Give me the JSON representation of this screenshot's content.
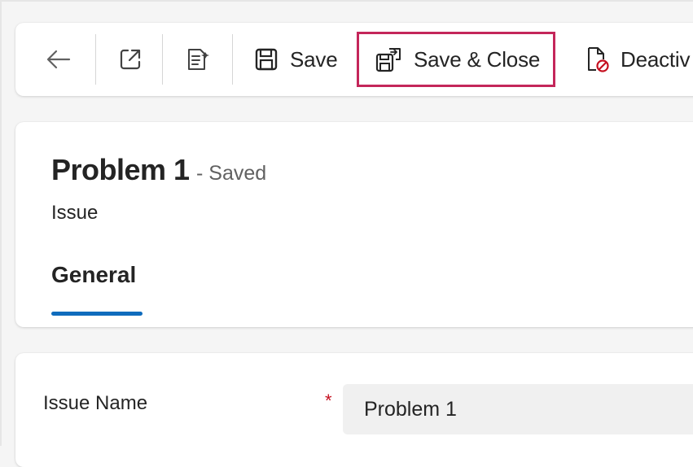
{
  "toolbar": {
    "back_icon": "back-arrow-icon",
    "popout_icon": "open-in-new-window-icon",
    "flow_icon": "flow-document-icon",
    "save_label": "Save",
    "save_close_label": "Save & Close",
    "deactivate_label": "Deactiv",
    "highlight_color": "#c4265a"
  },
  "header": {
    "title": "Problem 1",
    "status": "- Saved",
    "entity": "Issue",
    "tabs": [
      {
        "label": "General",
        "selected": true
      }
    ],
    "accent_color": "#0f6cbd"
  },
  "form": {
    "fields": [
      {
        "label": "Issue Name",
        "required": true,
        "required_marker": "*",
        "value": "Problem 1"
      }
    ]
  }
}
